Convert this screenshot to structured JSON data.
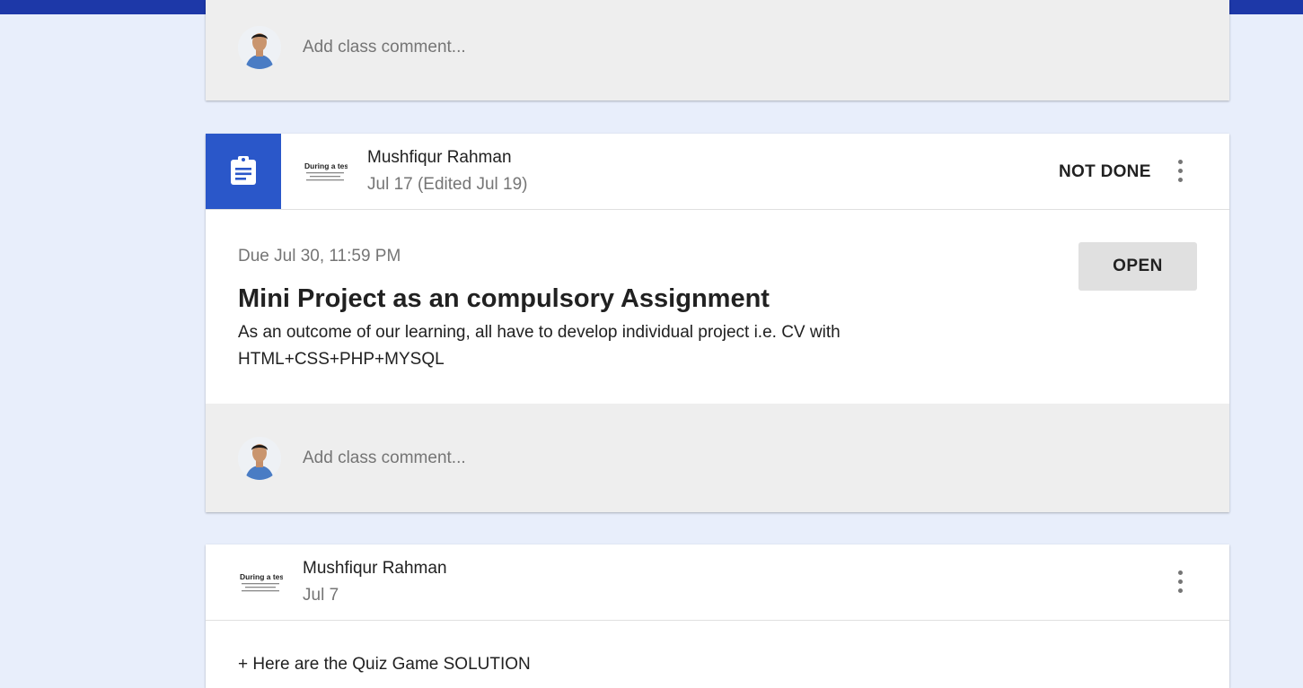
{
  "top_comment": {
    "placeholder": "Add class comment..."
  },
  "assignment_post": {
    "author": "Mushfiqur Rahman",
    "date": "Jul 17 (Edited Jul 19)",
    "status": "NOT DONE",
    "due": "Due Jul 30, 11:59 PM",
    "title": "Mini Project as an compulsory Assignment",
    "description": "As an outcome of our learning, all have to develop individual project i.e. CV with HTML+CSS+PHP+MYSQL",
    "open_label": "OPEN",
    "comment_placeholder": "Add class comment...",
    "thumb_text": "During a test,"
  },
  "next_post": {
    "author": "Mushfiqur Rahman",
    "date": "Jul 7",
    "thumb_text": "During a test,",
    "peek_text": "+ Here are the Quiz Game SOLUTION"
  },
  "colors": {
    "top_bar": "#1d38a8",
    "assignment_accent": "#2a57c9",
    "page_background": "#e8eefb"
  },
  "icons": {
    "assignment": "assignment-clipboard-icon",
    "more": "more-vert-icon"
  }
}
